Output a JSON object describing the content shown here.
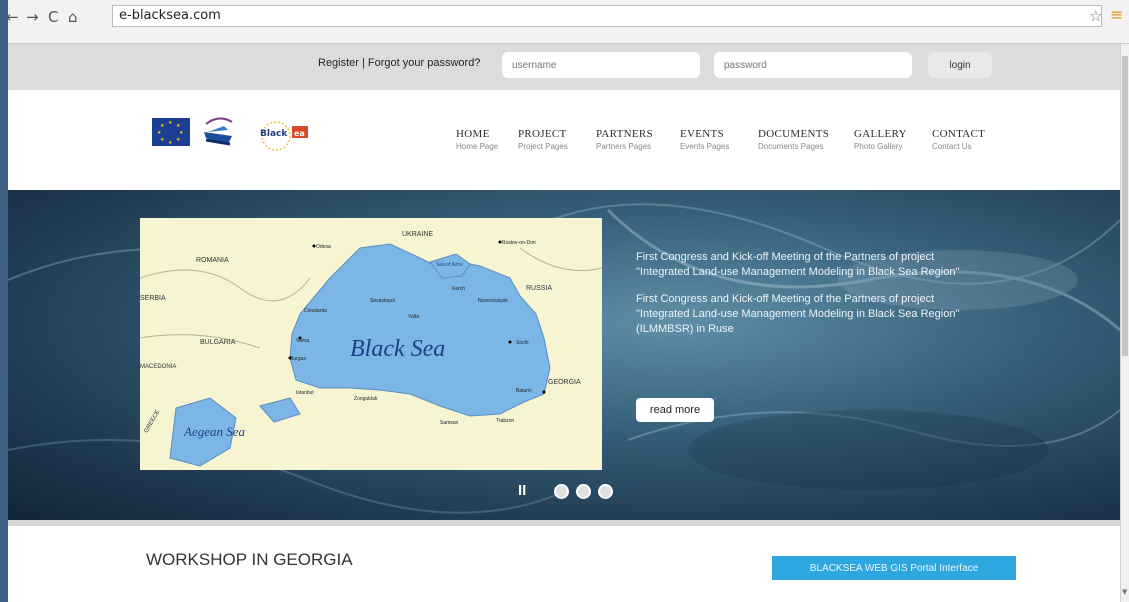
{
  "browser": {
    "back_icon": "←",
    "forward_icon": "→",
    "reload_icon": "C",
    "home_icon": "⌂",
    "url": "e-blacksea.com",
    "star_icon": "☆",
    "menu_icon": "≡"
  },
  "loginbar": {
    "register_text": "Register | Forgot your password?",
    "username_placeholder": "username",
    "password_placeholder": "password",
    "login_label": "login"
  },
  "nav": [
    {
      "title": "HOME",
      "sub": "Home Page"
    },
    {
      "title": "PROJECT",
      "sub": "Project Pages"
    },
    {
      "title": "PARTNERS",
      "sub": "Partners Pages"
    },
    {
      "title": "EVENTS",
      "sub": "Events Pages"
    },
    {
      "title": "DOCUMENTS",
      "sub": "Documents Pages"
    },
    {
      "title": "GALLERY",
      "sub": "Photo Gallery"
    },
    {
      "title": "CONTACT",
      "sub": "Contact Us"
    }
  ],
  "map": {
    "sea_label": "Black Sea",
    "aegean_label": "Aegean Sea",
    "azov_label": "Sea of Azov",
    "countries": [
      "ROMANIA",
      "UKRAINE",
      "RUSSIA",
      "SERBIA",
      "BULGARIA",
      "MACEDONIA",
      "GEORGIA",
      "GREECE"
    ],
    "cities": [
      "Odesa",
      "Rostov-on-Don",
      "Kerch",
      "Sevastopol",
      "Constanta",
      "Yalta",
      "Novorossiysk",
      "Varna",
      "Burgas",
      "Sochi",
      "Istanbul",
      "Zonguldak",
      "Samsun",
      "Batumi",
      "Trabzon"
    ]
  },
  "hero": {
    "paragraph1": "First Congress and Kick-off Meeting of the Partners of project \"Integrated Land-use Management Modeling in Black Sea Region\"",
    "paragraph2": "First Congress and Kick-off Meeting of the Partners of project \"Integrated Land-use Management Modeling in Black Sea Region\" (ILMMBSR) in Ruse",
    "read_more": "read more"
  },
  "slider": {
    "pause_icon": "II"
  },
  "bottom": {
    "workshop_title": "WORKSHOP IN GEORGIA",
    "blue_button": "BLACKSEA WEB GIS Portal Interface"
  },
  "colors": {
    "accent_blue": "#2ea7e0",
    "sea_blue": "#7cb6e6",
    "hero_dark": "#1f3a52"
  }
}
